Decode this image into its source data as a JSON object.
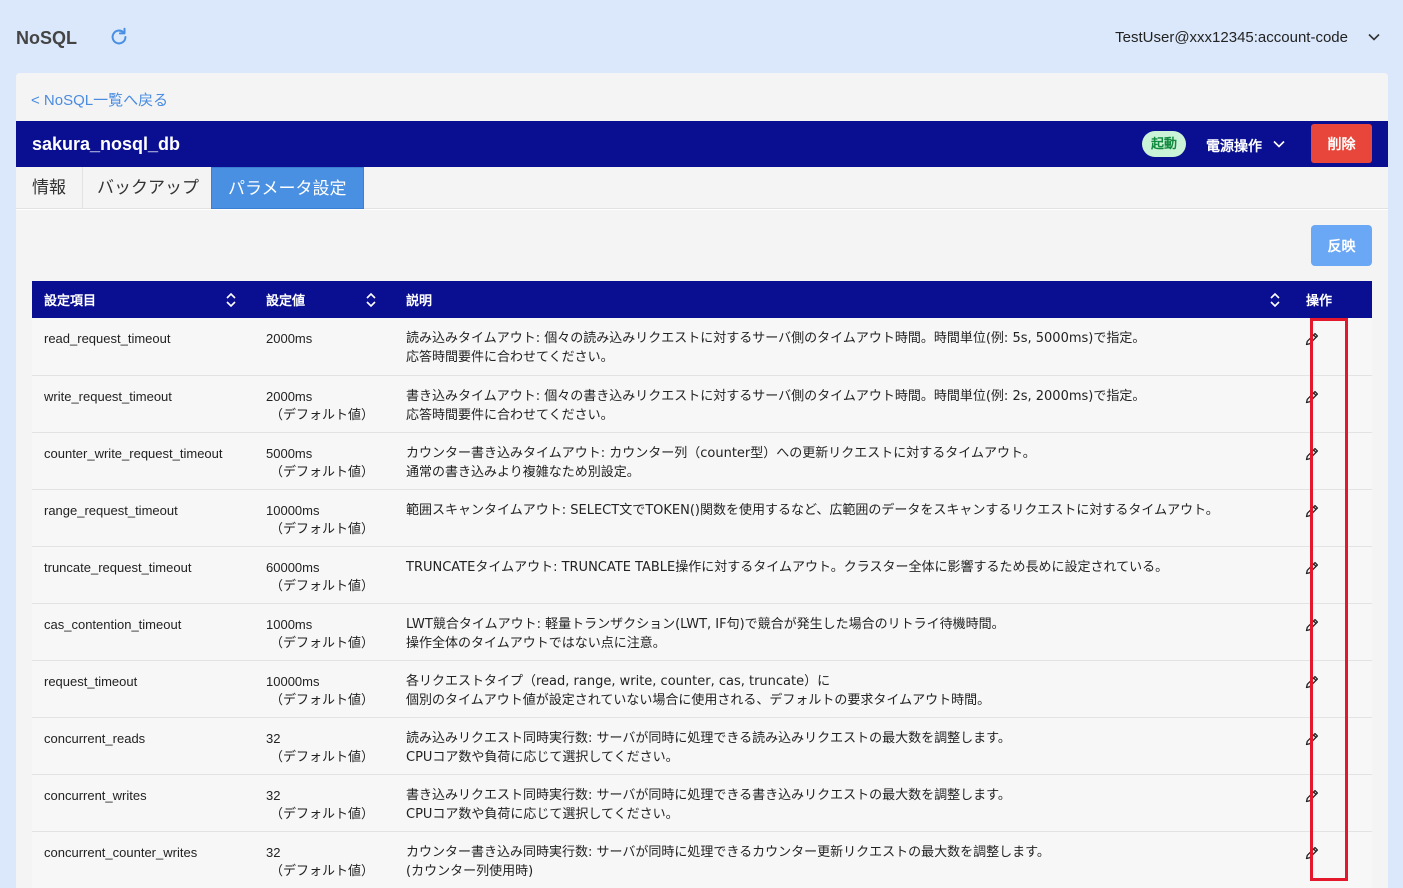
{
  "app": {
    "title": "NoSQL",
    "user": "TestUser@xxx12345:account-code"
  },
  "nav": {
    "back_label": "< NoSQL一覧へ戻る"
  },
  "resource": {
    "name": "sakura_nosql_db",
    "status": "起動",
    "status_color": "#118a3e",
    "power_label": "電源操作",
    "delete_label": "削除",
    "delete_color": "#e8463a"
  },
  "tabs": [
    {
      "label": "情報",
      "active": false
    },
    {
      "label": "バックアップ",
      "active": false
    },
    {
      "label": "パラメータ設定",
      "active": true
    }
  ],
  "toolbar": {
    "apply_label": "反映"
  },
  "table": {
    "headers": {
      "name": "設定項目",
      "value": "設定値",
      "desc": "説明",
      "op": "操作"
    },
    "rows": [
      {
        "name": "read_request_timeout",
        "value": "2000ms",
        "default": "",
        "desc1": "読み込みタイムアウト: 個々の読み込みリクエストに対するサーバ側のタイムアウト時間。時間単位(例: 5s, 5000ms)で指定。",
        "desc2": "応答時間要件に合わせてください。"
      },
      {
        "name": "write_request_timeout",
        "value": "2000ms",
        "default": "（デフォルト値）",
        "desc1": "書き込みタイムアウト: 個々の書き込みリクエストに対するサーバ側のタイムアウト時間。時間単位(例: 2s, 2000ms)で指定。",
        "desc2": "応答時間要件に合わせてください。"
      },
      {
        "name": "counter_write_request_timeout",
        "value": "5000ms",
        "default": "（デフォルト値）",
        "desc1": "カウンター書き込みタイムアウト: カウンター列（counter型）への更新リクエストに対するタイムアウト。",
        "desc2": "通常の書き込みより複雑なため別設定。"
      },
      {
        "name": "range_request_timeout",
        "value": "10000ms",
        "default": "（デフォルト値）",
        "desc1": "範囲スキャンタイムアウト: SELECT文でTOKEN()関数を使用するなど、広範囲のデータをスキャンするリクエストに対するタイムアウト。",
        "desc2": ""
      },
      {
        "name": "truncate_request_timeout",
        "value": "60000ms",
        "default": "（デフォルト値）",
        "desc1": "TRUNCATEタイムアウト: TRUNCATE TABLE操作に対するタイムアウト。クラスター全体に影響するため長めに設定されている。",
        "desc2": ""
      },
      {
        "name": "cas_contention_timeout",
        "value": "1000ms",
        "default": "（デフォルト値）",
        "desc1": "LWT競合タイムアウト: 軽量トランザクション(LWT, IF句)で競合が発生した場合のリトライ待機時間。",
        "desc2": "操作全体のタイムアウトではない点に注意。"
      },
      {
        "name": "request_timeout",
        "value": "10000ms",
        "default": "（デフォルト値）",
        "desc1": "各リクエストタイプ（read, range, write, counter, cas, truncate）に",
        "desc2": "個別のタイムアウト値が設定されていない場合に使用される、デフォルトの要求タイムアウト時間。"
      },
      {
        "name": "concurrent_reads",
        "value": "32",
        "default": "（デフォルト値）",
        "desc1": "読み込みリクエスト同時実行数: サーバが同時に処理できる読み込みリクエストの最大数を調整します。",
        "desc2": "CPUコア数や負荷に応じて選択してください。"
      },
      {
        "name": "concurrent_writes",
        "value": "32",
        "default": "（デフォルト値）",
        "desc1": "書き込みリクエスト同時実行数: サーバが同時に処理できる書き込みリクエストの最大数を調整します。",
        "desc2": "CPUコア数や負荷に応じて選択してください。"
      },
      {
        "name": "concurrent_counter_writes",
        "value": "32",
        "default": "（デフォルト値）",
        "desc1": "カウンター書き込み同時実行数: サーバが同時に処理できるカウンター更新リクエストの最大数を調整します。",
        "desc2": "(カウンター列使用時)"
      }
    ]
  },
  "colors": {
    "header_bg": "#0a0f91",
    "accent": "#4a90e2",
    "highlight": "#e3182d"
  },
  "icons": {
    "refresh": "refresh-icon",
    "chevron": "chevron-down-icon",
    "sort": "sort-icon",
    "edit": "pencil-icon"
  }
}
